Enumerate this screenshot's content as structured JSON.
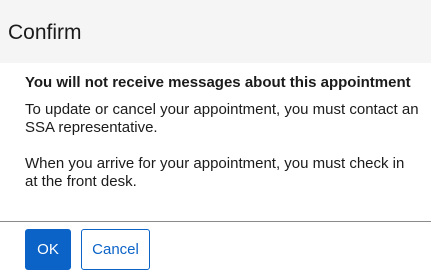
{
  "dialog": {
    "title": "Confirm",
    "heading": "You will not receive messages about this appointment",
    "paragraph1": "To update or cancel your appointment, you must contact an SSA representative.",
    "paragraph2": "When you arrive for your appointment, you must check in at the front desk."
  },
  "buttons": {
    "ok_label": "OK",
    "cancel_label": "Cancel"
  },
  "colors": {
    "primary": "#0b63c8",
    "header_bg": "#f5f5f5",
    "text": "#1b1b1b"
  }
}
